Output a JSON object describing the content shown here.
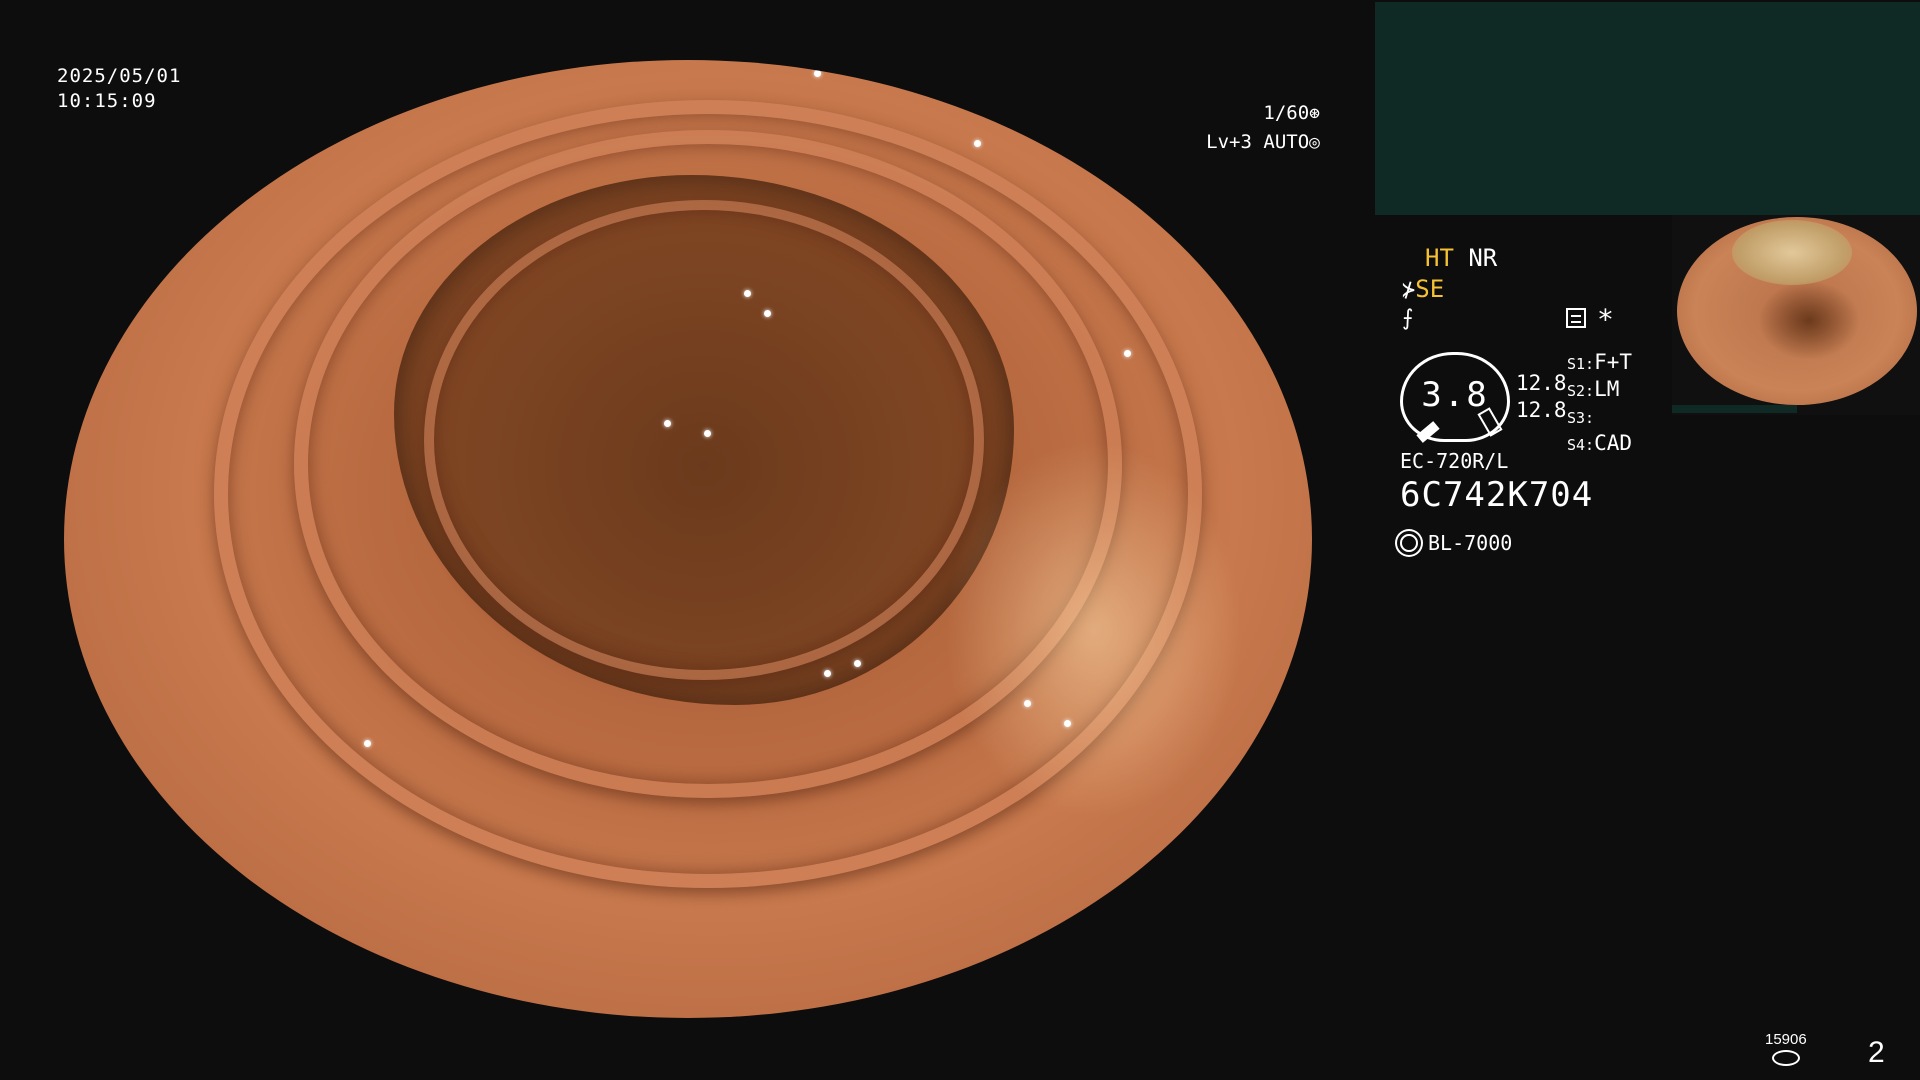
{
  "datetime": {
    "date": "2025/05/01",
    "time": "10:15:09"
  },
  "shutter": {
    "speed": "1/60",
    "level": "Lv+3",
    "iris": "AUTO"
  },
  "modes": {
    "ht": "HT",
    "nr": "NR",
    "se": "SE"
  },
  "gauge": {
    "value": "3.8",
    "upper": "12.8",
    "lower": "12.8"
  },
  "switches": {
    "s1": {
      "label": "S1:",
      "value": "F+T"
    },
    "s2": {
      "label": "S2:",
      "value": "LM"
    },
    "s3": {
      "label": "S3:",
      "value": ""
    },
    "s4": {
      "label": "S4:",
      "value": "CAD"
    }
  },
  "scope": {
    "model": "EC-720R/L",
    "serial": "6C742K704"
  },
  "light_source": "BL-7000",
  "storage_count": "15906",
  "page_number": "2",
  "colors": {
    "accent_yellow": "#f4c233",
    "panel_teal": "#0f2a24"
  },
  "icons": [
    "aperture-icon",
    "auto-iris-icon",
    "scope-connector-icon",
    "freeze-icon",
    "menu-icon",
    "star-icon",
    "light-source-icon",
    "disk-icon"
  ]
}
